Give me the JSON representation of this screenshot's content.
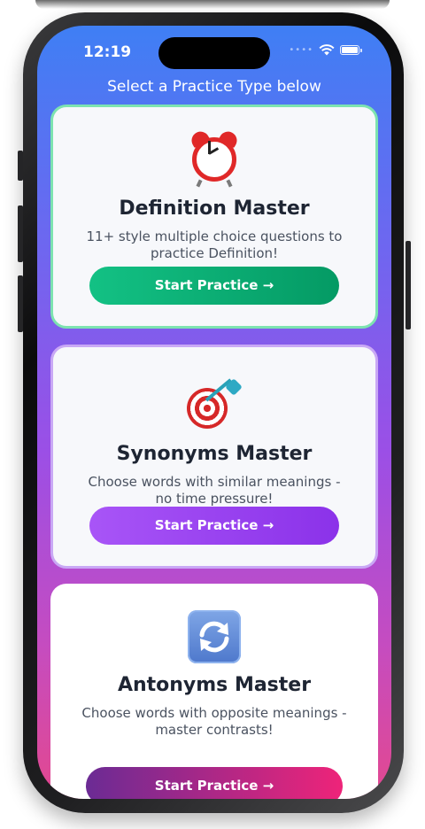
{
  "status_bar": {
    "time": "12:19"
  },
  "header": {
    "subtitle": "Select a Practice Type below"
  },
  "cards": [
    {
      "icon": "alarm-clock-icon",
      "title": "Definition Master",
      "description": "11+ style multiple choice questions to practice Definition!",
      "button_label": "Start Practice →",
      "accent": "#10b981"
    },
    {
      "icon": "target-dart-icon",
      "title": "Synonyms Master",
      "description": "Choose words with similar meanings - no time pressure!",
      "button_label": "Start Practice →",
      "accent": "#a855f7"
    },
    {
      "icon": "arrows-cycle-icon",
      "title": "Antonyms Master",
      "description": "Choose words with opposite meanings - master contrasts!",
      "button_label": "Start Practice →",
      "accent": "#ec4899"
    }
  ]
}
